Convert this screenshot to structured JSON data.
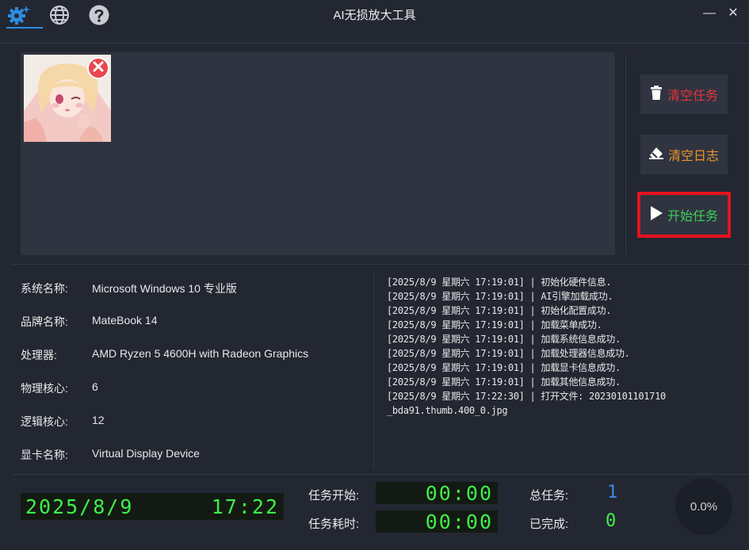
{
  "window": {
    "title": "AI无损放大工具",
    "minimize_glyph": "—",
    "close_glyph": "✕"
  },
  "toolbar": {
    "icons": [
      "settings-sparkle-icon",
      "globe-icon",
      "help-icon"
    ],
    "active_color": "#2b8de0"
  },
  "actions": {
    "clear_tasks": "清空任务",
    "clear_log": "清空日志",
    "start_task": "开始任务"
  },
  "system_info": [
    {
      "label": "系统名称:",
      "value": "Microsoft Windows 10 专业版"
    },
    {
      "label": "品牌名称:",
      "value": "MateBook 14"
    },
    {
      "label": "处理器:",
      "value": "AMD Ryzen 5 4600H with Radeon Graphics"
    },
    {
      "label": "物理核心:",
      "value": "6"
    },
    {
      "label": "逻辑核心:",
      "value": "12"
    },
    {
      "label": "显卡名称:",
      "value": "Virtual Display Device"
    }
  ],
  "log": [
    "[2025/8/9 星期六 17:19:01] | 初始化硬件信息.",
    "[2025/8/9 星期六 17:19:01] | AI引擎加载成功.",
    "[2025/8/9 星期六 17:19:01] | 初始化配置成功.",
    "[2025/8/9 星期六 17:19:01] | 加载菜单成功.",
    "[2025/8/9 星期六 17:19:01] | 加载系统信息成功.",
    "[2025/8/9 星期六 17:19:01] | 加载处理器信息成功.",
    "[2025/8/9 星期六 17:19:01] | 加载显卡信息成功.",
    "[2025/8/9 星期六 17:19:01] | 加载其他信息成功.",
    "[2025/8/9 星期六 17:22:30] | 打开文件: 20230101101710",
    "_bda91.thumb.400_0.jpg"
  ],
  "status": {
    "date": "2025/8/9",
    "time": "17:22",
    "task_start_label": "任务开始:",
    "task_start_value": "00:00",
    "task_elapsed_label": "任务耗时:",
    "task_elapsed_value": "00:00",
    "total_label": "总任务:",
    "total_value": "1",
    "done_label": "已完成:",
    "done_value": "0",
    "progress": "0.0%"
  },
  "colors": {
    "background": "#232732",
    "panel": "#2f3440",
    "clear_tasks": "#e8333c",
    "clear_log": "#f0932b",
    "start_task": "#3fce5a",
    "lcd_green": "#3ff04a",
    "total_blue": "#3a8ee6",
    "highlight_red": "#e8121d"
  }
}
